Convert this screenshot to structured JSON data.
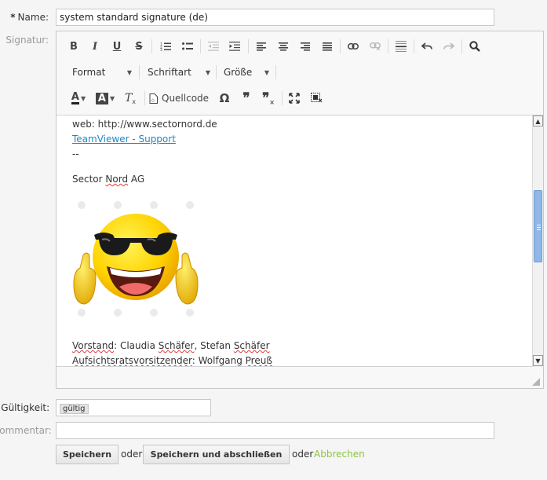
{
  "form": {
    "name_label": "Name:",
    "required_mark": "*",
    "name_value": "system standard signature (de)",
    "signature_label": "Signatur:",
    "validity_label": "Gültigkeit:",
    "validity_value": "gültig",
    "comment_label": "Kommentar:"
  },
  "toolbar": {
    "format_label": "Format",
    "font_label": "Schriftart",
    "size_label": "Größe",
    "source_label": "Quellcode"
  },
  "content": {
    "web_line": "web: http://www.sectornord.de",
    "teamviewer_link": "TeamViewer - Support",
    "dashes": "--",
    "company_prefix": "Sector ",
    "company_word": "Nord",
    "company_suffix": " AG",
    "board_word": "Vorstand",
    "board_rest": ": Claudia ",
    "board_name1": "Schäfer",
    "board_mid": ", Stefan ",
    "board_name2": "Schäfer",
    "chair_word": "Aufsichtsratsvorsitzender",
    "chair_mid": ": Wolfgang ",
    "chair_name": "Preuß"
  },
  "actions": {
    "save_label": "Speichern",
    "or1": "oder",
    "save_close_label": "Speichern und abschließen",
    "or2": "oder",
    "cancel_label": "Abbrechen"
  },
  "colors": {
    "link": "#1e88c7",
    "cancel_link": "#8cc63f"
  }
}
